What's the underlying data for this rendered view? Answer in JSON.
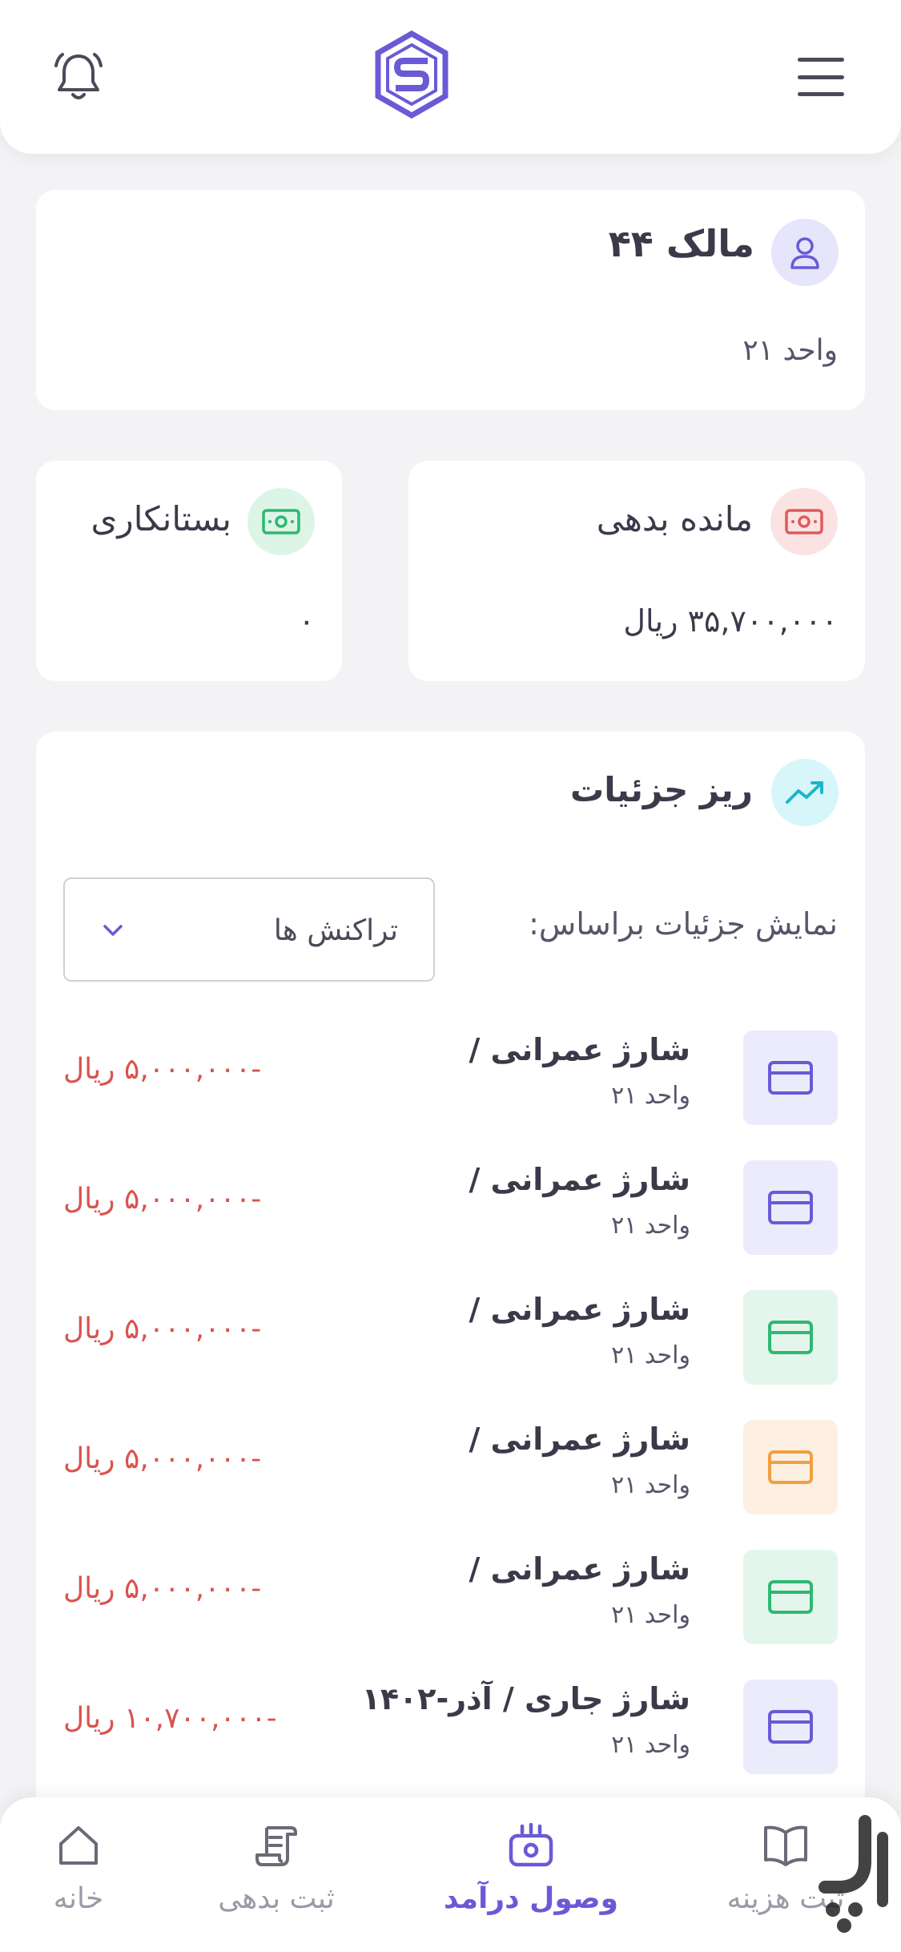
{
  "header": {
    "menu_icon": "hamburger-menu-icon",
    "logo_icon": "s-hexagon-logo",
    "bell_icon": "bell-icon"
  },
  "owner": {
    "name": "مالک ۴۴",
    "unit": "واحد ۲۱"
  },
  "balance": {
    "debt_label": "مانده بدهی",
    "debt_value": "۳۵,۷۰۰,۰۰۰ ریال",
    "credit_label": "بستانکاری",
    "credit_value": "۰"
  },
  "details": {
    "title": "ریز جزئیات",
    "filter_label": "نمایش جزئیات براساس:",
    "filter_value": "تراکنش ها",
    "transactions": [
      {
        "title": "شارژ عمرانی /",
        "unit": "واحد ۲۱",
        "amount": "-۵,۰۰۰,۰۰۰ ریال",
        "color": "#6a5ad6",
        "bg": "#ecebfc"
      },
      {
        "title": "شارژ عمرانی /",
        "unit": "واحد ۲۱",
        "amount": "-۵,۰۰۰,۰۰۰ ریال",
        "color": "#6a5ad6",
        "bg": "#ecebfc"
      },
      {
        "title": "شارژ عمرانی /",
        "unit": "واحد ۲۱",
        "amount": "-۵,۰۰۰,۰۰۰ ریال",
        "color": "#2eb872",
        "bg": "#e4f6ec"
      },
      {
        "title": "شارژ عمرانی /",
        "unit": "واحد ۲۱",
        "amount": "-۵,۰۰۰,۰۰۰ ریال",
        "color": "#f0a040",
        "bg": "#fdf0e2"
      },
      {
        "title": "شارژ عمرانی /",
        "unit": "واحد ۲۱",
        "amount": "-۵,۰۰۰,۰۰۰ ریال",
        "color": "#2eb872",
        "bg": "#e4f6ec"
      },
      {
        "title": "شارژ جاری / آذر-۱۴۰۲",
        "unit": "واحد ۲۱",
        "amount": "-۱۰,۷۰۰,۰۰۰ ریال",
        "color": "#6a5ad6",
        "bg": "#ecebfc"
      }
    ]
  },
  "nav": {
    "home": "خانه",
    "debt": "ثبت بدهی",
    "income": "وصول درآمد",
    "expense": "ثبت هزینه"
  },
  "colors": {
    "accent": "#6a5ad6",
    "negative": "#d9534f",
    "green": "#2eb872"
  }
}
